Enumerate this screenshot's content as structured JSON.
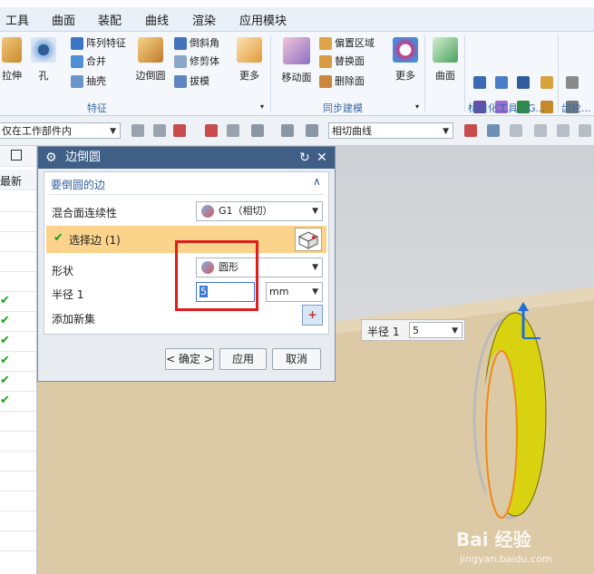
{
  "menu": [
    "工具",
    "曲面",
    "装配",
    "曲线",
    "渲染",
    "应用模块"
  ],
  "ribbon": {
    "big_buttons": [
      "拉伸",
      "孔",
      "边倒圆",
      "更多",
      "移动面",
      "更多",
      "曲面"
    ],
    "feature_small": [
      "阵列特征",
      "合并",
      "抽壳"
    ],
    "feature_small2": [
      "倒斜角",
      "修剪体",
      "拔模"
    ],
    "sync_small": [
      "偏置区域",
      "替换面",
      "删除面"
    ],
    "groups": [
      "特征",
      "同步建模",
      "标准化工具 - G...",
      "齿轮..."
    ]
  },
  "toolbar": {
    "scope": "仅在工作部件内",
    "curve_rule": "相切曲线"
  },
  "nav": {
    "header": "最新"
  },
  "dialog": {
    "title": "边倒圆",
    "section_title": "要倒圆的边",
    "continuity_label": "混合面连续性",
    "continuity_value": "G1（相切）",
    "select_edge": "选择边 (1)",
    "shape_label": "形状",
    "shape_value": "圆形",
    "radius_label": "半径 1",
    "radius_value": "5",
    "radius_unit": "mm",
    "add_set": "添加新集",
    "ok": "< 确定 >",
    "apply": "应用",
    "cancel": "取消"
  },
  "viewport": {
    "handle_label": "半径 1",
    "handle_value": "5"
  },
  "watermark": {
    "brand": "Bai 经验",
    "site": "jingyan.baidu.com"
  }
}
